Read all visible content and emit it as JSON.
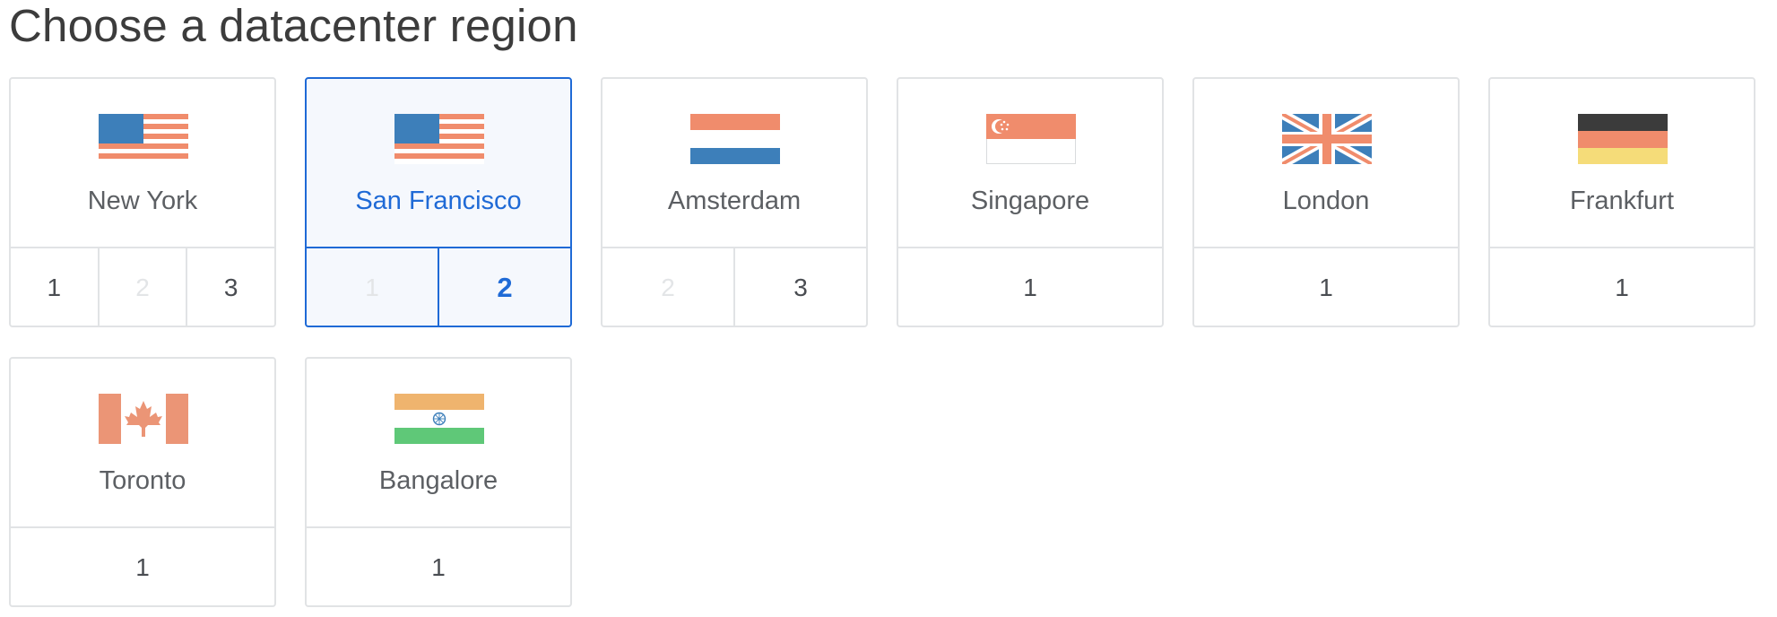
{
  "title": "Choose a datacenter region",
  "colors": {
    "accent": "#1f6ad6",
    "border": "#e1e3e5",
    "selected_bg": "#f5f8fd"
  },
  "regions": [
    {
      "name": "New York",
      "flag_icon": "us-flag-icon",
      "selected": false,
      "options": [
        {
          "label": "1",
          "disabled": false
        },
        {
          "label": "2",
          "disabled": true
        },
        {
          "label": "3",
          "disabled": false
        }
      ]
    },
    {
      "name": "San Francisco",
      "flag_icon": "us-flag-icon",
      "selected": true,
      "options": [
        {
          "label": "1",
          "disabled": true
        },
        {
          "label": "2",
          "disabled": false,
          "active": true
        }
      ]
    },
    {
      "name": "Amsterdam",
      "flag_icon": "netherlands-flag-icon",
      "selected": false,
      "options": [
        {
          "label": "2",
          "disabled": true
        },
        {
          "label": "3",
          "disabled": false
        }
      ]
    },
    {
      "name": "Singapore",
      "flag_icon": "singapore-flag-icon",
      "selected": false,
      "options": [
        {
          "label": "1",
          "disabled": false
        }
      ]
    },
    {
      "name": "London",
      "flag_icon": "uk-flag-icon",
      "selected": false,
      "options": [
        {
          "label": "1",
          "disabled": false
        }
      ]
    },
    {
      "name": "Frankfurt",
      "flag_icon": "germany-flag-icon",
      "selected": false,
      "options": [
        {
          "label": "1",
          "disabled": false
        }
      ]
    },
    {
      "name": "Toronto",
      "flag_icon": "canada-flag-icon",
      "selected": false,
      "options": [
        {
          "label": "1",
          "disabled": false
        }
      ]
    },
    {
      "name": "Bangalore",
      "flag_icon": "india-flag-icon",
      "selected": false,
      "options": [
        {
          "label": "1",
          "disabled": false
        }
      ]
    }
  ]
}
